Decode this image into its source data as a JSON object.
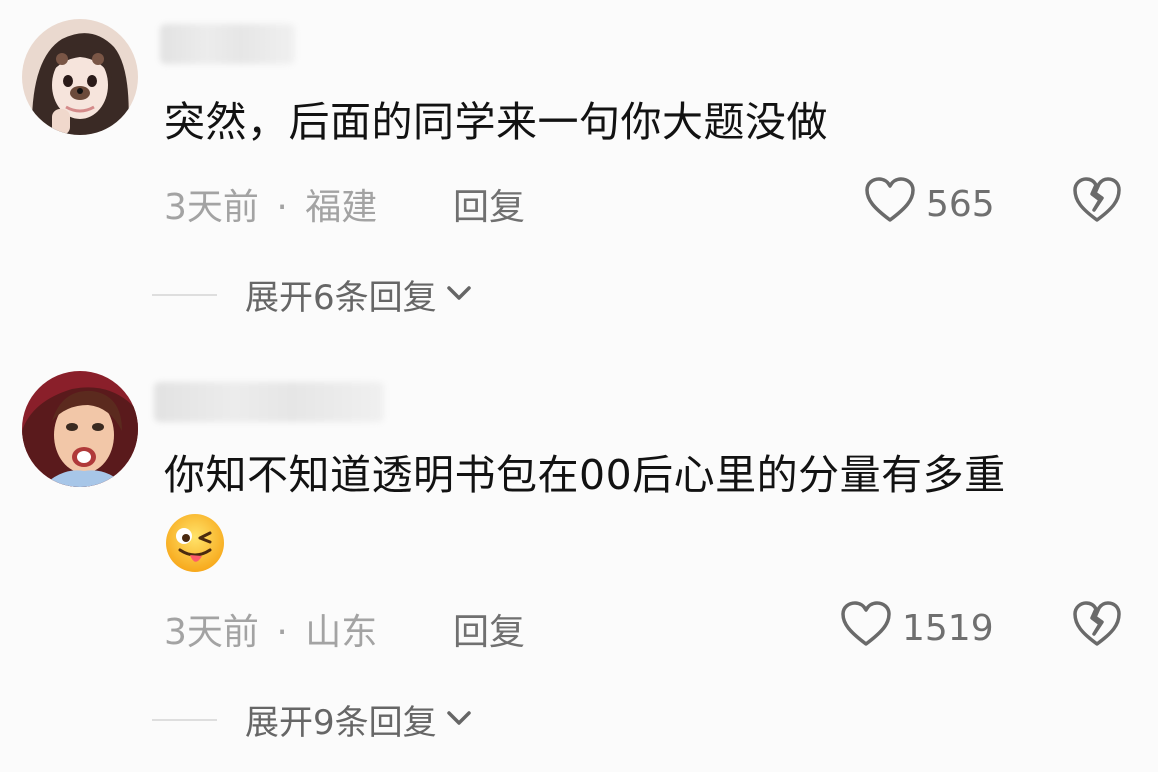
{
  "comments": [
    {
      "text": "突然，后面的同学来一句你大题没做",
      "time": "3天前",
      "separator": "·",
      "location": "福建",
      "reply_label": "回复",
      "likes": "565",
      "expand_label": "展开6条回复"
    },
    {
      "text": "你知不知道透明书包在00后心里的分量有多重",
      "emoji": "😜",
      "time": "3天前",
      "separator": "·",
      "location": "山东",
      "reply_label": "回复",
      "likes": "1519",
      "expand_label": "展开9条回复"
    }
  ],
  "icons": {
    "like": "heart-outline-icon",
    "dislike": "broken-heart-icon",
    "expand": "chevron-down-icon"
  },
  "colors": {
    "background": "#fbfbfb",
    "text": "#121212",
    "meta": "#a3a3a3",
    "action": "#707070"
  }
}
